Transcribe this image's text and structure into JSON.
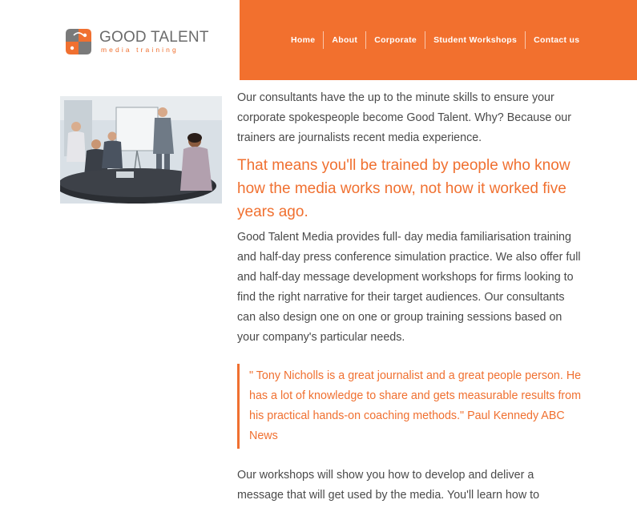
{
  "brand": {
    "name": "GOOD TALENT",
    "tagline": "media training",
    "accent": "#f2702e"
  },
  "nav": {
    "items": [
      "Home",
      "About",
      "Corporate",
      "Student Workshops",
      "Contact us"
    ]
  },
  "content": {
    "intro": "Our consultants have the up to the minute skills to ensure your corporate spokespeople become Good Talent. Why? Because our trainers are journalists recent media experience.",
    "lead": "That means you'll be trained by people who know how the media works now, not how it worked five years ago.",
    "body": "Good Talent Media provides full- day media familiarisation training and half-day press conference simulation practice. We also offer full and half-day message development workshops for firms looking to find the right narrative for their target audiences. Our consultants can also design one on one or group training sessions based on your company's particular needs.",
    "quote": "\" Tony Nicholls is a great journalist and a great people person. He has a lot of knowledge to share and gets measurable results from his practical hands-on coaching methods.\" Paul Kennedy ABC News",
    "closing": "Our workshops will show you how to develop and deliver a message that will get used by the media. You'll learn how to"
  },
  "icons": {
    "logo": "good-talent-logo-icon",
    "photo": "business-meeting-photo"
  }
}
